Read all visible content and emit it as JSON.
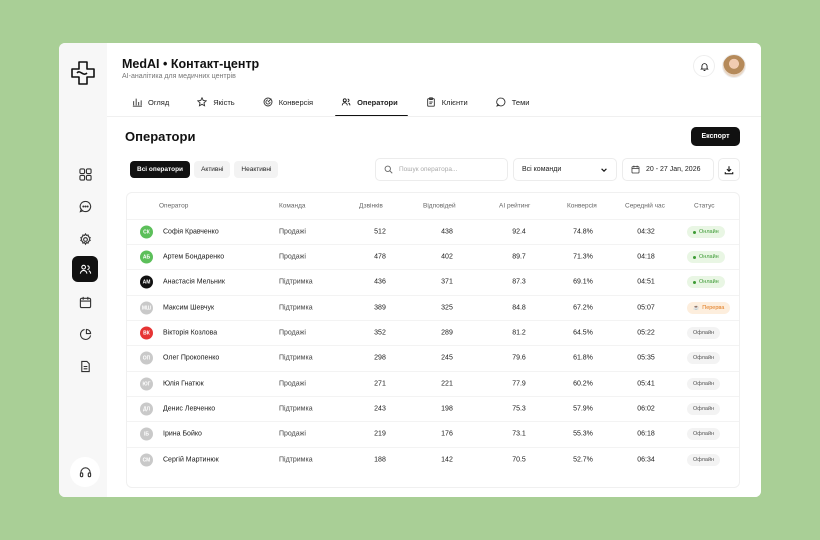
{
  "app": {
    "title": "MedAI • Контакт-центр",
    "subtitle": "AI-аналітика для медичних центрів"
  },
  "tabs": [
    {
      "label": "Огляд",
      "icon": "bar-chart-icon"
    },
    {
      "label": "Якість",
      "icon": "star-icon"
    },
    {
      "label": "Конверсія",
      "icon": "target-icon"
    },
    {
      "label": "Оператори",
      "icon": "users-icon",
      "active": true
    },
    {
      "label": "Клієнти",
      "icon": "clipboard-icon"
    },
    {
      "label": "Теми",
      "icon": "chat-bubble-icon"
    }
  ],
  "page": {
    "title": "Оператори",
    "export_label": "Експорт"
  },
  "filters": [
    {
      "label": "Всі оператори",
      "active": true
    },
    {
      "label": "Активні",
      "active": false
    },
    {
      "label": "Неактивні",
      "active": false
    }
  ],
  "search": {
    "placeholder": "Пошук оператора..."
  },
  "team_select": {
    "value": "Всі команди"
  },
  "date_range": {
    "value": "20 - 27 Jan, 2026"
  },
  "table": {
    "headers": {
      "operator": "Оператор",
      "team": "Команда",
      "calls": "Дзвінків",
      "answered": "Відповідей",
      "ai": "AI рейтинг",
      "conversion": "Конверсія",
      "avg": "Середній час",
      "status": "Статус"
    },
    "rows": [
      {
        "initials": "СК",
        "avatar_color": "#5cbf5a",
        "name": "Софія Кравченко",
        "team": "Продажі",
        "calls": "512",
        "answered": "438",
        "ai": "92.4",
        "conversion": "74.8%",
        "avg": "04:32",
        "status": "Онлайн"
      },
      {
        "initials": "АБ",
        "avatar_color": "#5cbf5a",
        "name": "Артем Бондаренко",
        "team": "Продажі",
        "calls": "478",
        "answered": "402",
        "ai": "89.7",
        "conversion": "71.3%",
        "avg": "04:18",
        "status": "Онлайн"
      },
      {
        "initials": "АМ",
        "avatar_color": "#111111",
        "name": "Анастасія Мельник",
        "team": "Підтримка",
        "calls": "436",
        "answered": "371",
        "ai": "87.3",
        "conversion": "69.1%",
        "avg": "04:51",
        "status": "Онлайн"
      },
      {
        "initials": "МШ",
        "avatar_color": "#c9c9c9",
        "name": "Максим Шевчук",
        "team": "Підтримка",
        "calls": "389",
        "answered": "325",
        "ai": "84.8",
        "conversion": "67.2%",
        "avg": "05:07",
        "status": "Перерва"
      },
      {
        "initials": "ВК",
        "avatar_color": "#e63434",
        "name": "Вікторія Козлова",
        "team": "Продажі",
        "calls": "352",
        "answered": "289",
        "ai": "81.2",
        "conversion": "64.5%",
        "avg": "05:22",
        "status": "Офлайн"
      },
      {
        "initials": "ОП",
        "avatar_color": "#c9c9c9",
        "name": "Олег Прокопенко",
        "team": "Підтримка",
        "calls": "298",
        "answered": "245",
        "ai": "79.6",
        "conversion": "61.8%",
        "avg": "05:35",
        "status": "Офлайн"
      },
      {
        "initials": "ЮГ",
        "avatar_color": "#c9c9c9",
        "name": "Юлія Гнатюк",
        "team": "Продажі",
        "calls": "271",
        "answered": "221",
        "ai": "77.9",
        "conversion": "60.2%",
        "avg": "05:41",
        "status": "Офлайн"
      },
      {
        "initials": "ДЛ",
        "avatar_color": "#c9c9c9",
        "name": "Денис Левченко",
        "team": "Підтримка",
        "calls": "243",
        "answered": "198",
        "ai": "75.3",
        "conversion": "57.9%",
        "avg": "06:02",
        "status": "Офлайн"
      },
      {
        "initials": "ІБ",
        "avatar_color": "#c9c9c9",
        "name": "Ірина Бойко",
        "team": "Продажі",
        "calls": "219",
        "answered": "176",
        "ai": "73.1",
        "conversion": "55.3%",
        "avg": "06:18",
        "status": "Офлайн"
      },
      {
        "initials": "СМ",
        "avatar_color": "#c9c9c9",
        "name": "Сергій Мартинюк",
        "team": "Підтримка",
        "calls": "188",
        "answered": "142",
        "ai": "70.5",
        "conversion": "52.7%",
        "avg": "06:34",
        "status": "Офлайн"
      }
    ]
  },
  "colors": {
    "online_bg": "#e9f6e4",
    "online_fg": "#3c9a34",
    "break_bg": "#fdeedd",
    "break_fg": "#e07a1e",
    "offline_bg": "#f3f3f3",
    "offline_fg": "#555555"
  }
}
